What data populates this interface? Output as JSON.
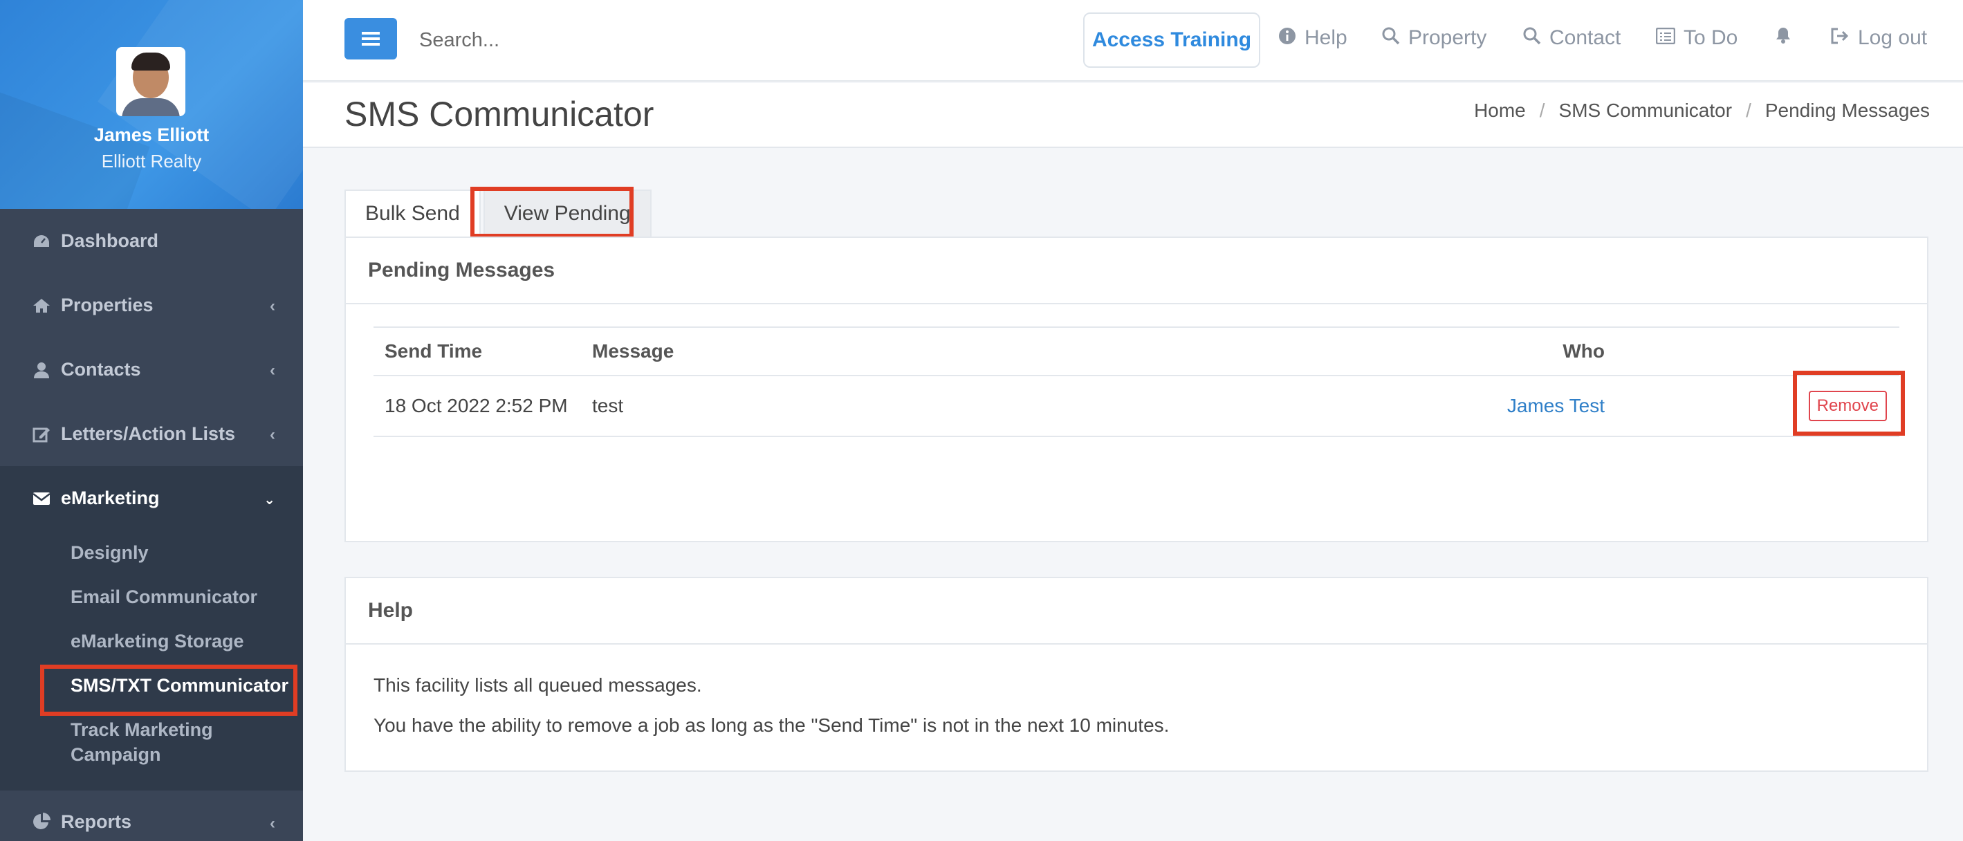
{
  "user": {
    "name": "James Elliott",
    "company": "Elliott Realty"
  },
  "sidebar": {
    "items": [
      {
        "label": "Dashboard",
        "icon": "dashboard-icon",
        "has_chevron": false
      },
      {
        "label": "Properties",
        "icon": "home-icon",
        "has_chevron": true
      },
      {
        "label": "Contacts",
        "icon": "user-icon",
        "has_chevron": true
      },
      {
        "label": "Letters/Action Lists",
        "icon": "edit-icon",
        "has_chevron": true
      },
      {
        "label": "eMarketing",
        "icon": "envelope-icon",
        "has_chevron": true,
        "expanded": true
      },
      {
        "label": "Reports",
        "icon": "pie-chart-icon",
        "has_chevron": true
      }
    ],
    "emarketing_sub": [
      "Designly",
      "Email Communicator",
      "eMarketing Storage",
      "SMS/TXT Communicator",
      "Track Marketing Campaign"
    ]
  },
  "topbar": {
    "search_placeholder": "Search...",
    "access_training": "Access Training",
    "links": [
      "Help",
      "Property",
      "Contact",
      "To Do",
      "Log out"
    ]
  },
  "page": {
    "title": "SMS Communicator",
    "breadcrumb": [
      "Home",
      "SMS Communicator",
      "Pending Messages"
    ]
  },
  "tabs": [
    "Bulk Send",
    "View Pending"
  ],
  "pending": {
    "title": "Pending Messages",
    "columns": [
      "Send Time",
      "Message",
      "Who"
    ],
    "rows": [
      {
        "send_time": "18 Oct 2022 2:52 PM",
        "message": "test",
        "who": "James Test",
        "action": "Remove"
      }
    ]
  },
  "help": {
    "title": "Help",
    "lines": [
      "This facility lists all queued messages.",
      "You have the ability to remove a job as long as the \"Send Time\" is not in the next 10 minutes."
    ]
  },
  "colors": {
    "accent": "#3a8ee0",
    "sidebar": "#3a4557",
    "highlight": "#e03d24",
    "danger": "#e0454d"
  }
}
